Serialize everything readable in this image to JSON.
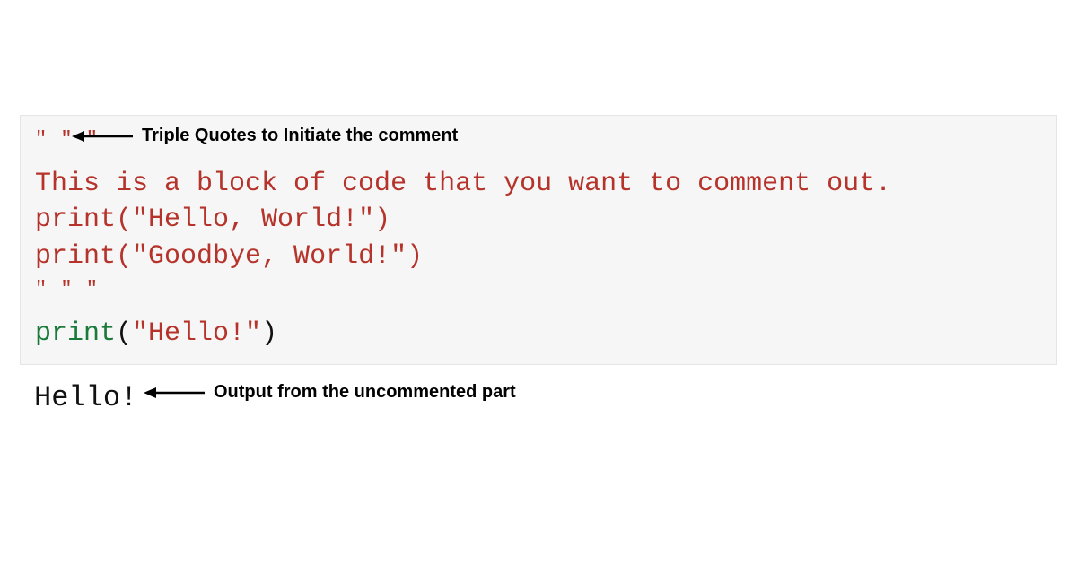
{
  "code": {
    "triple_open": "\" \" \"",
    "line1": "This is a block of code that you want to comment out.",
    "line2_print": "print",
    "line2_paren_open": "(",
    "line2_str": "\"Hello, World!\"",
    "line2_paren_close": ")",
    "line3_print": "print",
    "line3_paren_open": "(",
    "line3_str": "\"Goodbye, World!\"",
    "line3_paren_close": ")",
    "triple_close": "\" \" \"",
    "line_exec_print": "print",
    "line_exec_paren_open": "(",
    "line_exec_str": "\"Hello!\"",
    "line_exec_paren_close": ")"
  },
  "output": {
    "text": "Hello!"
  },
  "annotations": {
    "top": "Triple Quotes to Initiate the comment",
    "bottom": "Output from the uncommented part"
  }
}
